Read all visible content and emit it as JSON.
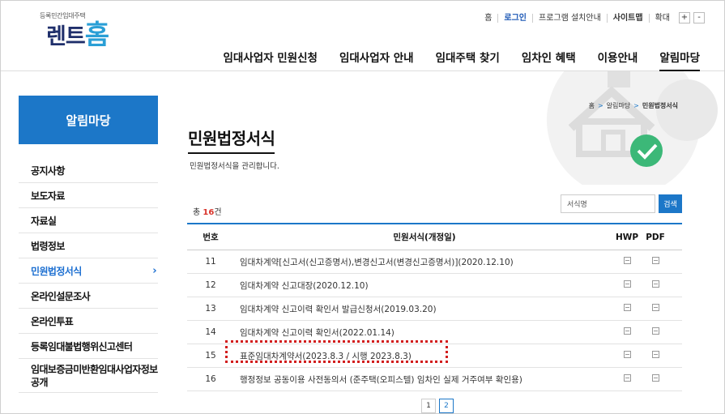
{
  "logo": {
    "tagline": "등록민간임대주택",
    "part1": "렌",
    "part2": "트",
    "part3": "홈"
  },
  "utility": {
    "home": "홈",
    "login": "로그인",
    "install": "프로그램 설치안내",
    "sitemap": "사이트맵",
    "zoom": "확대",
    "zoom_in": "+",
    "zoom_out": "-"
  },
  "gnb": [
    "임대사업자 민원신청",
    "임대사업자 안내",
    "임대주택 찾기",
    "임차인 혜택",
    "이용안내",
    "알림마당"
  ],
  "sidebar": {
    "title": "알림마당",
    "items": [
      "공지사항",
      "보도자료",
      "자료실",
      "법령정보",
      "민원법정서식",
      "온라인설문조사",
      "온라인투표",
      "등록임대불법행위신고센터",
      "임대보증금미반환임대사업자정보공개"
    ],
    "arrow": "›"
  },
  "breadcrumb": {
    "home": "홈",
    "sep": ">",
    "section": "알림마당",
    "current": "민원법정서식"
  },
  "page": {
    "title": "민원법정서식",
    "description": "민원법정서식을 관리합니다."
  },
  "total": {
    "prefix": "총 ",
    "count": "16",
    "suffix": "건"
  },
  "search": {
    "placeholder": "서식명",
    "button": "검색"
  },
  "table": {
    "headers": {
      "no": "번호",
      "title": "민원서식(개정일)",
      "hwp": "HWP",
      "pdf": "PDF"
    },
    "rows": [
      {
        "no": "11",
        "title": "임대차계약[신고서(신고증명서),변경신고서(변경신고증명서)](2020.12.10)"
      },
      {
        "no": "12",
        "title": "임대차계약 신고대장(2020.12.10)"
      },
      {
        "no": "13",
        "title": "임대차계약 신고이력 확인서 발급신청서(2019.03.20)"
      },
      {
        "no": "14",
        "title": "임대차계약 신고이력 확인서(2022.01.14)"
      },
      {
        "no": "15",
        "title": "표준임대차계약서(2023.8.3 / 시행 2023.8.3)"
      },
      {
        "no": "16",
        "title": "행정정보 공동이용 사전동의서 (준주택(오피스텔) 임차인 실제 거주여부 확인용)"
      }
    ]
  },
  "pagination": {
    "pages": [
      "1",
      "2"
    ],
    "current": "2"
  },
  "colors": {
    "primary": "#1c77c8",
    "highlight": "#d21d1d",
    "count": "#d9342b"
  }
}
